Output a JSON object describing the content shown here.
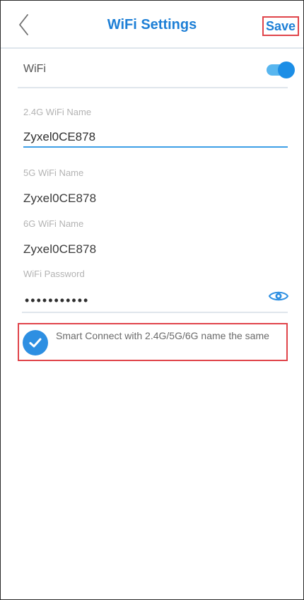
{
  "header": {
    "title": "WiFi Settings",
    "save_label": "Save"
  },
  "wifi": {
    "label": "WiFi",
    "enabled": true
  },
  "fields": {
    "name_24_label": "2.4G WiFi Name",
    "name_24_value": "Zyxel0CE878",
    "name_5_label": "5G WiFi Name",
    "name_5_value": "Zyxel0CE878",
    "name_6_label": "6G WiFi Name",
    "name_6_value": "Zyxel0CE878",
    "password_label": "WiFi Password",
    "password_masked": "•••••••••••"
  },
  "smart_connect": {
    "checked": true,
    "text": "Smart Connect with 2.4G/5G/6G name the same"
  },
  "colors": {
    "accent": "#1d7fd6",
    "highlight_border": "#e0444a"
  },
  "icons": {
    "back": "chevron-left-icon",
    "toggle": "toggle-switch-icon",
    "password_visibility": "eye-icon",
    "checked": "check-circle-icon"
  }
}
